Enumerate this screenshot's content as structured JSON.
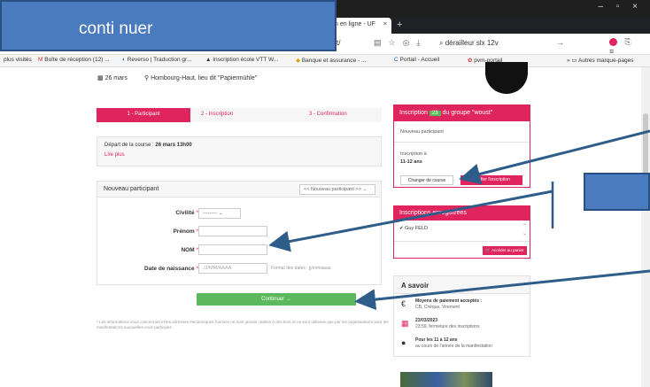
{
  "overlay": {
    "label": "conti nuer"
  },
  "browser": {
    "tab_title": "n en ligne - UF",
    "tab_close": "×",
    "new_tab": "+",
    "window_buttons": "– ▫ ×",
    "url_fragment": "t/",
    "search_text": "dérailleur slx 12v",
    "bookmarks": [
      "plus visités",
      "Boîte de réception (12) ...",
      "Reverso | Traduction gr...",
      "Inscription école VTT W...",
      "Banque et assurance - ...",
      "Portail - Accueil",
      "pvm-portail",
      "Autres marque-pages"
    ]
  },
  "event": {
    "date": "26 mars",
    "location": "Hombourg-Haut, lieu dit \"Papiermühle\""
  },
  "steps": [
    "1 - Participant",
    "2 - Inscription",
    "3 - Confirmation"
  ],
  "depart": {
    "label": "Départ de la course :",
    "value": "26 mars 13h00",
    "link": "Lire plus"
  },
  "form": {
    "title": "Nouveau participant",
    "participant_select": "<< Nouveau participant >>",
    "fields": {
      "civilite_label": "Civilité",
      "civilite_value": "---------",
      "prenom_label": "Prénom",
      "nom_label": "NOM",
      "ddn_label": "Date de naissance",
      "ddn_placeholder": "JJ/MM/AAAA",
      "ddn_hint": "Format des dates : jj/mm/aaaa",
      "required_mark": "*"
    },
    "submit": "Continuer →",
    "footnote": "* Les informations vous concernant et les adresses électroniques fournies ne sont jamais cédées à des tiers et ne sont utilisées que par les organisateurs pour les manifestations auxquelles vous participez."
  },
  "inscription": {
    "head_prefix": "Inscription",
    "count": "23",
    "head_suffix": "du groupe \"woust\"",
    "new_participant": "Nouveau participant",
    "inscription_label": "Inscription à",
    "age_group": "11-12 ans",
    "btn_changer": "Changer de course",
    "btn_verifier": "Vérifier l'inscription"
  },
  "registered": {
    "head": "Inscriptions enregistrées",
    "person": "Guy FELD",
    "btn_acceder": "Accéder au panier"
  },
  "savoir": {
    "head": "A savoir",
    "payment_title": "Moyens de paiement acceptés :",
    "payment_value": "CB, Chèque, Virement",
    "close_date": "23/03/2023",
    "close_text": "23:59, fermeture des inscriptions",
    "age_title": "Pour les 11 à 12 ans",
    "age_text": "au cours de l'année de la manifestation"
  },
  "colors": {
    "accent": "#e0245e",
    "green": "#5cb85c",
    "overlay_blue": "#4a7bbf",
    "arrow": "#2e5d8a"
  },
  "icons": {
    "calendar": "calendar-icon",
    "location": "location-pin-icon",
    "euro": "euro-icon",
    "calendar_red": "calendar-red-icon",
    "person": "person-icon",
    "check": "checkmark-icon",
    "cart": "cart-icon"
  }
}
